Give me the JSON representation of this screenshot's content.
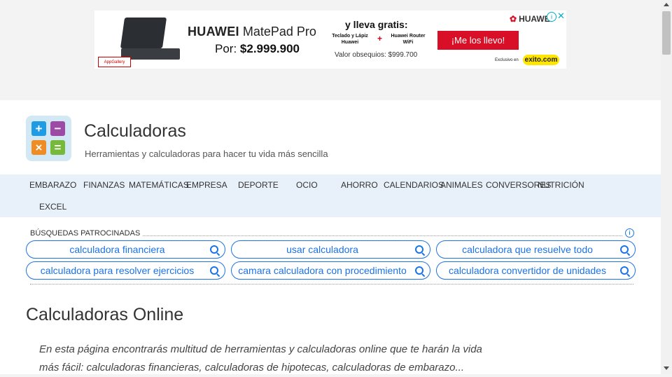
{
  "ad": {
    "headline_brand": "HUAWEI",
    "headline_product": "MatePad Pro",
    "price_prefix": "Por:",
    "price": "$2.999.900",
    "gratis": "y lleva gratis:",
    "item1": "Teclado y Lápiz Huawei",
    "plus": "+",
    "item2": "Huawei Router WiFi",
    "obsequios": "Valor obsequios: $999.700",
    "cta": "¡Me los llevo!",
    "brand": "HUAWEI",
    "exclusivo": "Exclusivo en",
    "exito": "exito.com",
    "appgallery": "AppGallery"
  },
  "site": {
    "title": "Calculadoras",
    "tagline": "Herramientas y calculadoras para hacer tu vida más sencilla"
  },
  "logo": {
    "plus": "+",
    "minus": "−",
    "times": "×",
    "equals": "="
  },
  "nav": {
    "items": [
      "EMBARAZO",
      "FINANZAS",
      "MATEMÁTICAS",
      "EMPRESA",
      "DEPORTE",
      "OCIO",
      "AHORRO",
      "CALENDARIOS",
      "ANIMALES",
      "CONVERSORES",
      "NUTRICIÓN",
      "EXCEL"
    ]
  },
  "sponsored": {
    "label": "BÚSQUEDAS PATROCINADAS",
    "info_icon": "i",
    "searches": [
      "calculadora financiera",
      "usar calculadora",
      "calculadora que resuelve todo",
      "calculadora para resolver ejercicios",
      "camara calculadora con procedimiento",
      "calculadora convertidor de unidades"
    ]
  },
  "main": {
    "heading": "Calculadoras Online",
    "intro": "En esta página encontrarás multitud de herramientas y calculadoras online que te harán la vida más fácil: calculadoras financieras, calculadoras de hipotecas, calculadoras de embarazo..."
  }
}
